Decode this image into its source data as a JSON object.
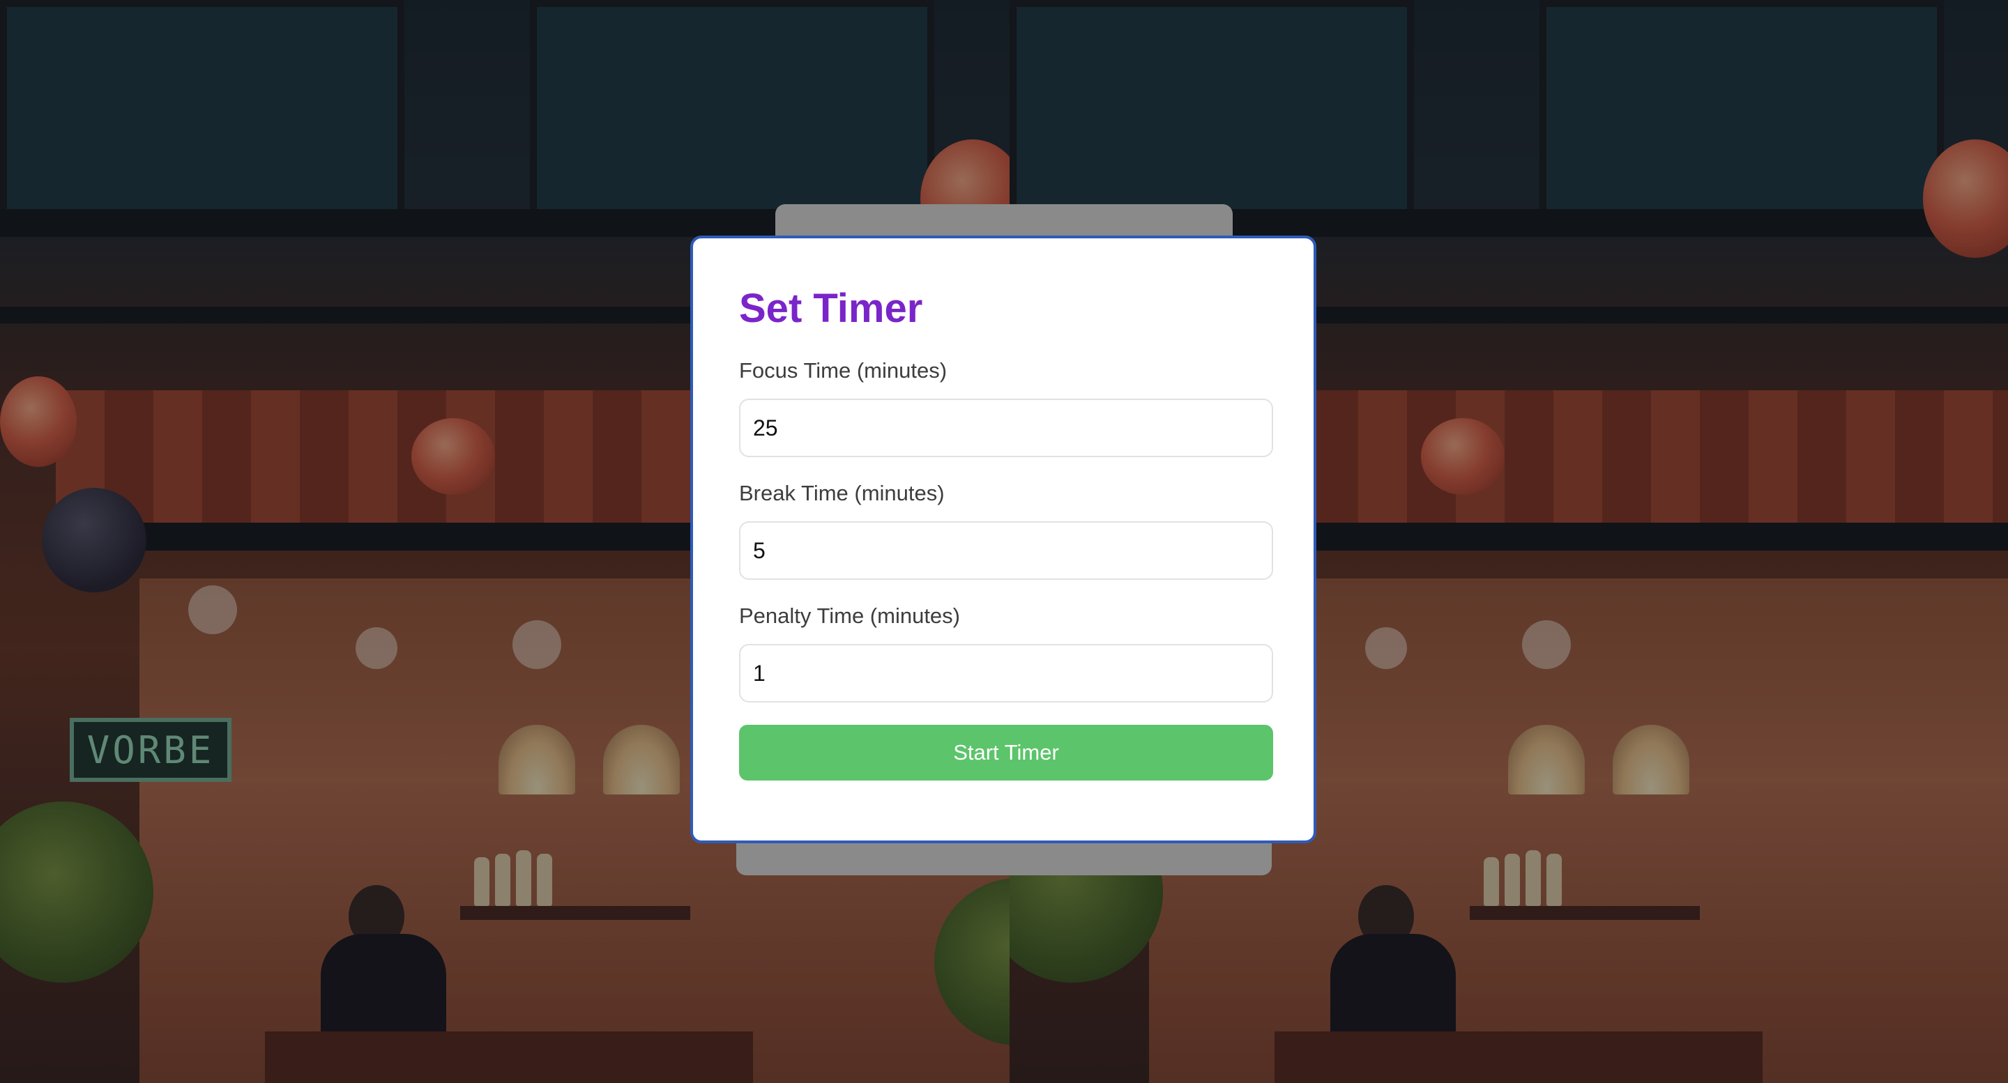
{
  "modal": {
    "title": "Set Timer",
    "fields": [
      {
        "label": "Focus Time (minutes)",
        "value": "25"
      },
      {
        "label": "Break Time (minutes)",
        "value": "5"
      },
      {
        "label": "Penalty Time (minutes)",
        "value": "1"
      }
    ],
    "start_label": "Start Timer"
  },
  "background": {
    "sign_text": "VORBE"
  },
  "colors": {
    "title": "#7a25c9",
    "button": "#5cc46a",
    "modal_border": "#2f5bb8"
  }
}
